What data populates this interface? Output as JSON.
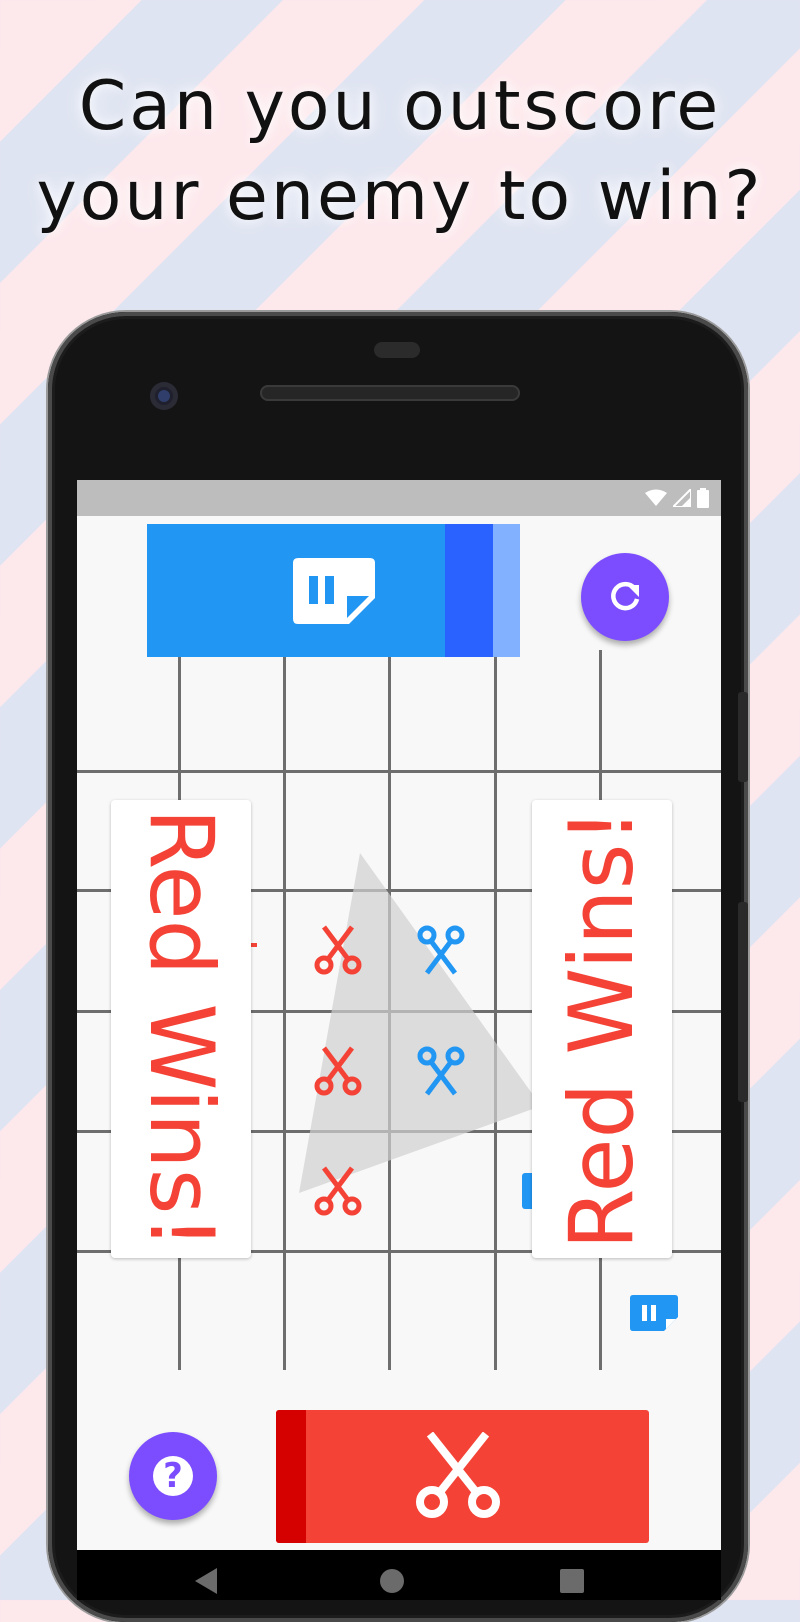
{
  "headline": {
    "line1": "Can you outscore",
    "line2": "your enemy to win?"
  },
  "game": {
    "left_banner": "Red Wins!",
    "right_banner": "Red Wins!",
    "help_label": "?",
    "red_player": {
      "color": "#f44336",
      "icon": "scissors-icon"
    },
    "blue_player": {
      "color": "#2196f3",
      "icon": "paper-icon"
    },
    "board_pieces": [
      {
        "row": 2,
        "col": 2,
        "player": "red",
        "icon": "scissors-icon"
      },
      {
        "row": 2,
        "col": 3,
        "player": "blue",
        "icon": "scissors-icon"
      },
      {
        "row": 3,
        "col": 2,
        "player": "red",
        "icon": "scissors-icon"
      },
      {
        "row": 3,
        "col": 3,
        "player": "blue",
        "icon": "scissors-icon"
      },
      {
        "row": 4,
        "col": 2,
        "player": "red",
        "icon": "scissors-icon"
      }
    ]
  },
  "system": {
    "status_icons": [
      "wifi-icon",
      "signal-icon",
      "battery-icon"
    ],
    "nav_buttons": [
      "back-icon",
      "home-icon",
      "recents-icon"
    ]
  }
}
